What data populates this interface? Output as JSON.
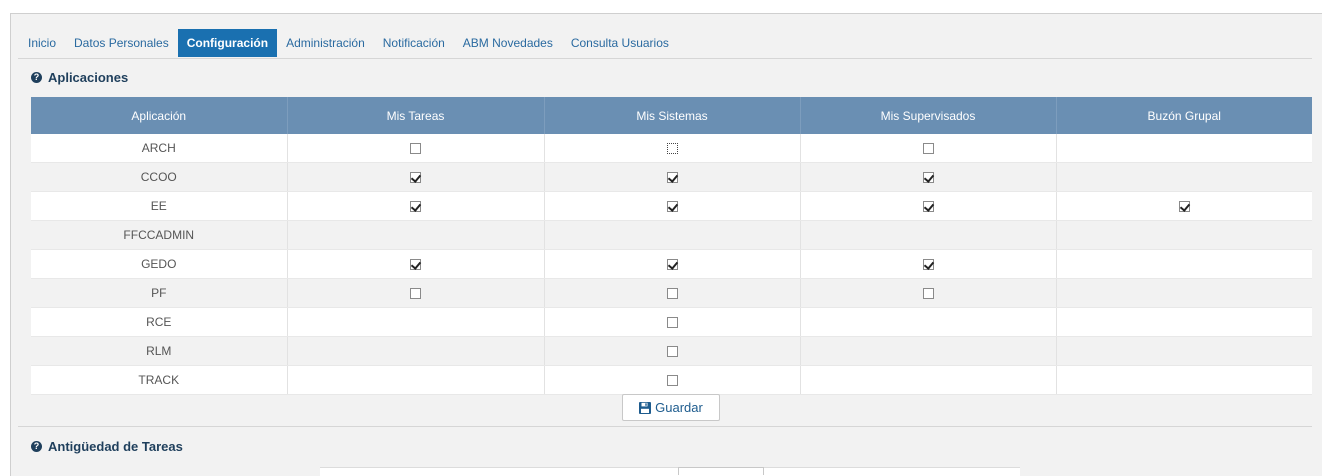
{
  "tabs": [
    {
      "label": "Inicio",
      "active": false
    },
    {
      "label": "Datos Personales",
      "active": false
    },
    {
      "label": "Configuración",
      "active": true
    },
    {
      "label": "Administración",
      "active": false
    },
    {
      "label": "Notificación",
      "active": false
    },
    {
      "label": "ABM Novedades",
      "active": false
    },
    {
      "label": "Consulta Usuarios",
      "active": false
    }
  ],
  "sections": {
    "aplicaciones_title": "Aplicaciones",
    "antiguedad_title": "Antigüedad de Tareas"
  },
  "table": {
    "headers": [
      "Aplicación",
      "Mis Tareas",
      "Mis Sistemas",
      "Mis Supervisados",
      "Buzón Grupal"
    ],
    "rows": [
      {
        "app": "ARCH",
        "cells": [
          "unchecked",
          "unchecked",
          "unchecked",
          "none"
        ]
      },
      {
        "app": "CCOO",
        "cells": [
          "checked",
          "checked",
          "checked",
          "none"
        ]
      },
      {
        "app": "EE",
        "cells": [
          "checked",
          "checked",
          "checked",
          "checked"
        ]
      },
      {
        "app": "FFCCADMIN",
        "cells": [
          "none",
          "none",
          "none",
          "none"
        ]
      },
      {
        "app": "GEDO",
        "cells": [
          "checked",
          "checked",
          "checked",
          "none"
        ]
      },
      {
        "app": "PF",
        "cells": [
          "unchecked",
          "unchecked",
          "unchecked",
          "none"
        ]
      },
      {
        "app": "RCE",
        "cells": [
          "none",
          "unchecked",
          "none",
          "none"
        ]
      },
      {
        "app": "RLM",
        "cells": [
          "none",
          "unchecked",
          "none",
          "none"
        ]
      },
      {
        "app": "TRACK",
        "cells": [
          "none",
          "unchecked",
          "none",
          "none"
        ]
      }
    ]
  },
  "buttons": {
    "guardar": "Guardar"
  },
  "icons": {
    "help": "question-circle-icon",
    "save": "floppy-disk-icon"
  },
  "colors": {
    "active_tab": "#1a70b0",
    "table_header": "#6a8fb3",
    "title": "#1f3f5c"
  }
}
